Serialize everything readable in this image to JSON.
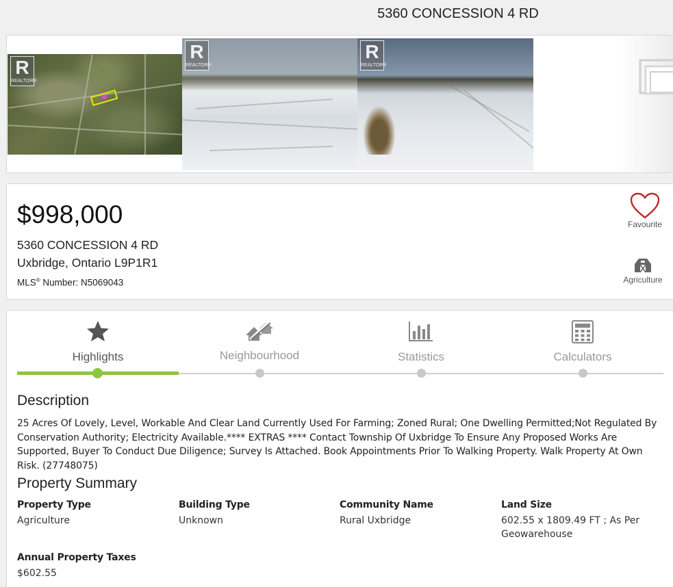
{
  "page": {
    "title": "5360 CONCESSION 4 RD"
  },
  "gallery": {
    "watermark_letter": "R",
    "watermark_text": "REALTOR®",
    "photos": [
      {
        "name": "aerial-map-photo"
      },
      {
        "name": "snowy-field-photo"
      },
      {
        "name": "snowy-tracks-photo"
      }
    ],
    "more_icon": "photo-stack-icon"
  },
  "listing": {
    "price": "$998,000",
    "address_line1": "5360 CONCESSION 4 RD",
    "address_line2": "Uxbridge, Ontario L9P1R1",
    "mls_label": "MLS",
    "mls_superscript": "®",
    "mls_rest": " Number: N5069043",
    "favourite_label": "Favourite",
    "favourite_icon": "heart-icon",
    "favourite_color": "#c0272d",
    "property_category_label": "Agriculture",
    "property_category_icon": "barn-icon"
  },
  "tabs": [
    {
      "label": "Highlights",
      "icon": "star-icon",
      "active": true
    },
    {
      "label": "Neighbourhood",
      "icon": "neighbourhood-icon",
      "active": false
    },
    {
      "label": "Statistics",
      "icon": "bar-chart-icon",
      "active": false
    },
    {
      "label": "Calculators",
      "icon": "calculator-icon",
      "active": false
    }
  ],
  "accent_color": "#8cc63f",
  "description": {
    "title": "Description",
    "text": "25 Acres Of Lovely, Level, Workable And Clear Land Currently Used For Farming; Zoned Rural; One Dwelling Permitted;Not Regulated By Conservation Authority; Electricity Available.**** EXTRAS **** Contact Township Of Uxbridge To Ensure Any Proposed Works Are Supported, Buyer To Conduct Due Diligence; Survey Is Attached. Book Appointments Prior To Walking Property. Walk Property At Own Risk. (27748075)"
  },
  "summary": {
    "title": "Property Summary",
    "items": [
      {
        "label": "Property Type",
        "value": "Agriculture"
      },
      {
        "label": "Building Type",
        "value": "Unknown"
      },
      {
        "label": "Community Name",
        "value": "Rural Uxbridge"
      },
      {
        "label": "Land Size",
        "value": "602.55 x 1809.49 FT ; As Per Geowarehouse"
      },
      {
        "label": "Annual Property Taxes",
        "value": "$602.55"
      }
    ]
  }
}
